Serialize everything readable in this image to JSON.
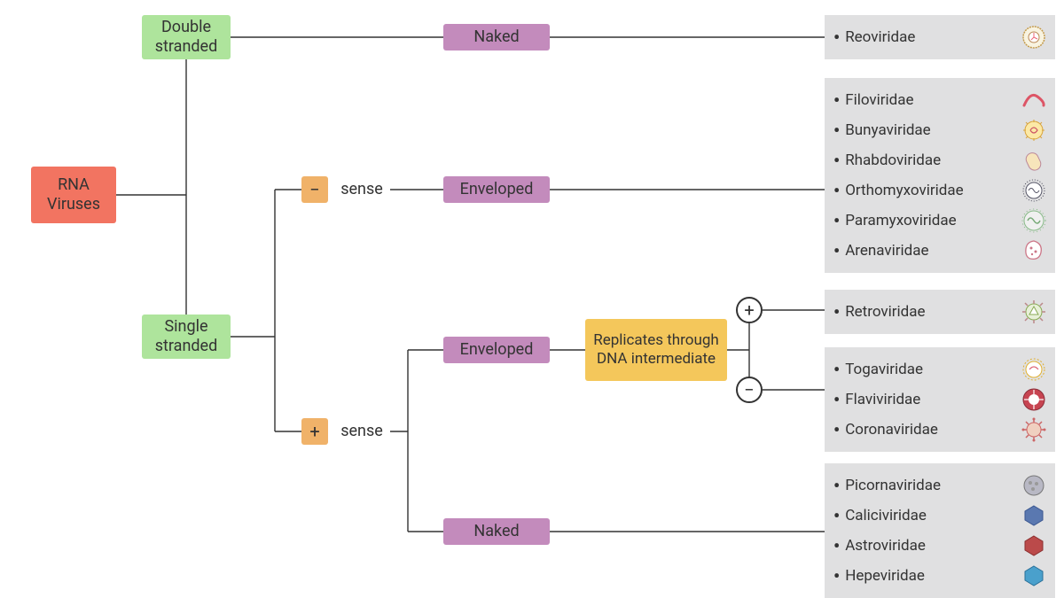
{
  "root": "RNA Viruses",
  "doubleStranded": "Double stranded",
  "singleStranded": "Single stranded",
  "minusSign": "−",
  "plusSign": "+",
  "senseWord": "sense",
  "naked": "Naked",
  "enveloped": "Enveloped",
  "replicates": "Replicates through DNA intermediate",
  "circlePlus": "+",
  "circleMinus": "−",
  "panels": {
    "reov": [
      "Reoviridae"
    ],
    "negEnv": [
      "Filoviridae",
      "Bunyaviridae",
      "Rhabdoviridae",
      "Orthomyxoviridae",
      "Paramyxoviridae",
      "Arenaviridae"
    ],
    "retro": [
      "Retroviridae"
    ],
    "posEnvNoDNA": [
      "Togaviridae",
      "Flaviviridae",
      "Coronaviridae"
    ],
    "posNaked": [
      "Picornaviridae",
      "Caliciviridae",
      "Astroviridae",
      "Hepeviridae"
    ]
  },
  "icons": {
    "reov": "reoviridae-icon",
    "negEnv": [
      "filoviridae-icon",
      "bunyaviridae-icon",
      "rhabdoviridae-icon",
      "orthomyxoviridae-icon",
      "paramyxoviridae-icon",
      "arenaviridae-icon"
    ],
    "retro": "retroviridae-icon",
    "posEnvNoDNA": [
      "togaviridae-icon",
      "flaviviridae-icon",
      "coronaviridae-icon"
    ],
    "posNaked": [
      "picornaviridae-icon",
      "caliciviridae-icon",
      "astroviridae-icon",
      "hepeviridae-icon"
    ]
  }
}
